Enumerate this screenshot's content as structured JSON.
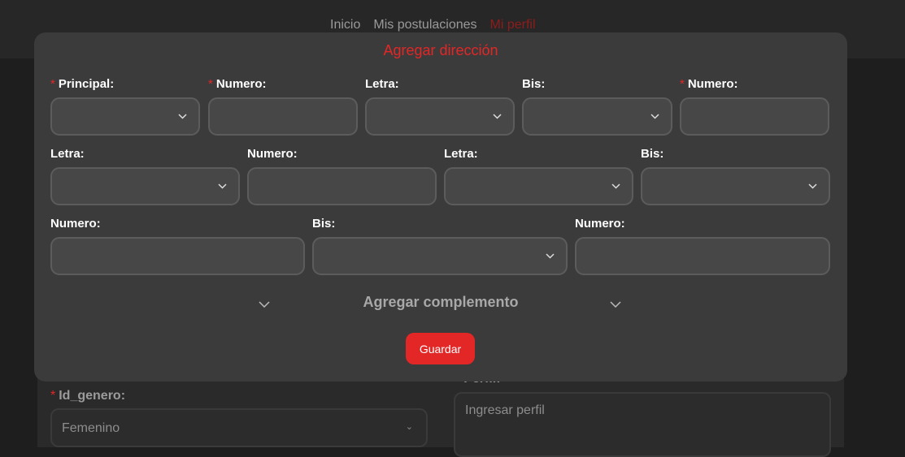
{
  "nav": {
    "items": [
      "Inicio",
      "Mis postulaciones",
      "Mi perfil"
    ]
  },
  "background": {
    "gender_label": "Id_genero:",
    "gender_value": "Femenino",
    "profile_label": "Perfil:",
    "profile_placeholder": "Ingresar perfil"
  },
  "modal": {
    "title": "Agregar dirección",
    "row1": [
      {
        "label": "Principal:",
        "required": true,
        "type": "select"
      },
      {
        "label": "Numero:",
        "required": true,
        "type": "input"
      },
      {
        "label": "Letra:",
        "required": false,
        "type": "select"
      },
      {
        "label": "Bis:",
        "required": false,
        "type": "select"
      },
      {
        "label": "Numero:",
        "required": true,
        "type": "input"
      }
    ],
    "row2": [
      {
        "label": "Letra:",
        "type": "select"
      },
      {
        "label": "Numero:",
        "type": "input"
      },
      {
        "label": "Letra:",
        "type": "select"
      },
      {
        "label": "Bis:",
        "type": "select"
      }
    ],
    "row3": [
      {
        "label": "Numero:",
        "type": "input"
      },
      {
        "label": "Bis:",
        "type": "select"
      },
      {
        "label": "Numero:",
        "type": "input"
      }
    ],
    "complement": "Agregar complemento",
    "save": "Guardar"
  },
  "colors": {
    "accent": "#e32727"
  }
}
